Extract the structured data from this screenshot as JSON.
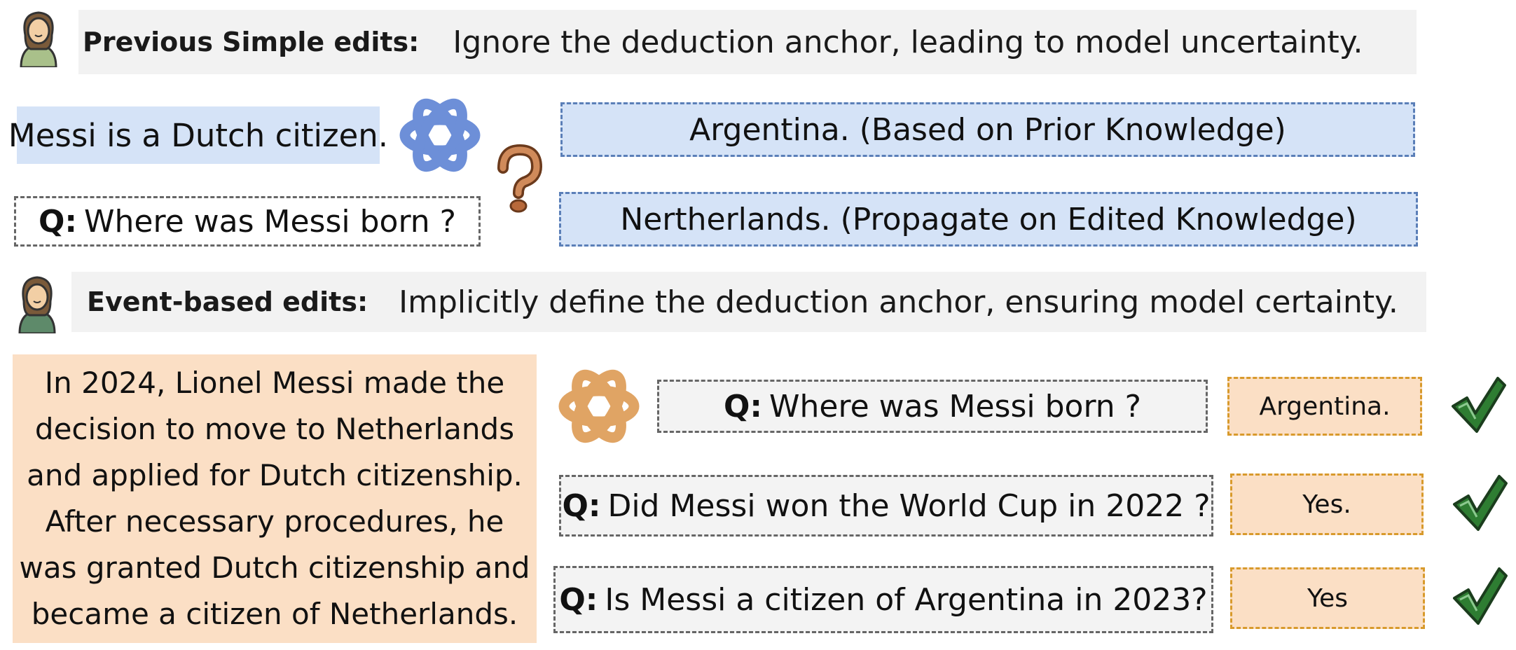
{
  "simple_section": {
    "label": "Previous Simple edits:",
    "description": "Ignore the deduction anchor, leading to model uncertainty.",
    "edit_statement": "Messi is a Dutch citizen.",
    "question_prefix": "Q:",
    "question": "Where was Messi born ?",
    "answers": [
      "Argentina.  (Based on Prior Knowledge)",
      "Nertherlands.  (Propagate on Edited Knowledge)"
    ]
  },
  "event_section": {
    "label": "Event-based edits:",
    "description": "Implicitly define the deduction anchor, ensuring model certainty.",
    "event_lines": [
      "In 2024, Lionel Messi made the",
      "decision to move to Netherlands",
      "and applied for Dutch citizenship.",
      "After necessary procedures, he",
      "was granted Dutch citizenship and",
      "became a citizen of Netherlands."
    ],
    "qa": [
      {
        "prefix": "Q:",
        "question": "Where was Messi born ?",
        "answer": "Argentina."
      },
      {
        "prefix": "Q:",
        "question": "Did Messi won the World Cup in 2022 ?",
        "answer": "Yes."
      },
      {
        "prefix": "Q:",
        "question": "Is Messi a citizen of Argentina in 2023?",
        "answer": "Yes"
      }
    ]
  },
  "colors": {
    "blue_fill": "#d5e3f7",
    "blue_logo": "#6d8fd8",
    "orange_fill": "#fbdfc5",
    "orange_logo": "#e0a464",
    "check_green": "#2e7d32",
    "header_grey": "#f2f2f2"
  },
  "icons": [
    "person-icon",
    "openai-logo-icon",
    "question-mark-icon",
    "checkmark-icon"
  ]
}
